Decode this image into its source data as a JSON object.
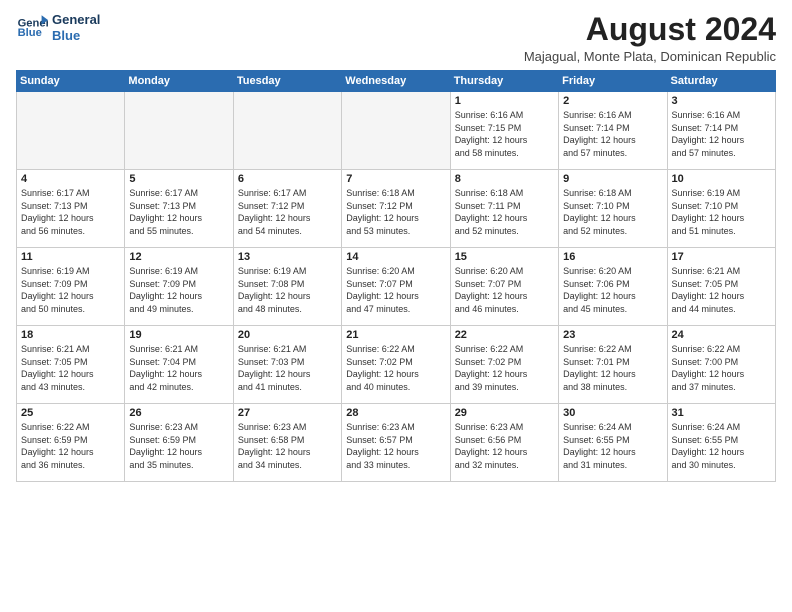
{
  "header": {
    "logo_line1": "General",
    "logo_line2": "Blue",
    "main_title": "August 2024",
    "subtitle": "Majagual, Monte Plata, Dominican Republic"
  },
  "calendar": {
    "days_of_week": [
      "Sunday",
      "Monday",
      "Tuesday",
      "Wednesday",
      "Thursday",
      "Friday",
      "Saturday"
    ],
    "weeks": [
      [
        {
          "day": "",
          "info": ""
        },
        {
          "day": "",
          "info": ""
        },
        {
          "day": "",
          "info": ""
        },
        {
          "day": "",
          "info": ""
        },
        {
          "day": "1",
          "info": "Sunrise: 6:16 AM\nSunset: 7:15 PM\nDaylight: 12 hours\nand 58 minutes."
        },
        {
          "day": "2",
          "info": "Sunrise: 6:16 AM\nSunset: 7:14 PM\nDaylight: 12 hours\nand 57 minutes."
        },
        {
          "day": "3",
          "info": "Sunrise: 6:16 AM\nSunset: 7:14 PM\nDaylight: 12 hours\nand 57 minutes."
        }
      ],
      [
        {
          "day": "4",
          "info": "Sunrise: 6:17 AM\nSunset: 7:13 PM\nDaylight: 12 hours\nand 56 minutes."
        },
        {
          "day": "5",
          "info": "Sunrise: 6:17 AM\nSunset: 7:13 PM\nDaylight: 12 hours\nand 55 minutes."
        },
        {
          "day": "6",
          "info": "Sunrise: 6:17 AM\nSunset: 7:12 PM\nDaylight: 12 hours\nand 54 minutes."
        },
        {
          "day": "7",
          "info": "Sunrise: 6:18 AM\nSunset: 7:12 PM\nDaylight: 12 hours\nand 53 minutes."
        },
        {
          "day": "8",
          "info": "Sunrise: 6:18 AM\nSunset: 7:11 PM\nDaylight: 12 hours\nand 52 minutes."
        },
        {
          "day": "9",
          "info": "Sunrise: 6:18 AM\nSunset: 7:10 PM\nDaylight: 12 hours\nand 52 minutes."
        },
        {
          "day": "10",
          "info": "Sunrise: 6:19 AM\nSunset: 7:10 PM\nDaylight: 12 hours\nand 51 minutes."
        }
      ],
      [
        {
          "day": "11",
          "info": "Sunrise: 6:19 AM\nSunset: 7:09 PM\nDaylight: 12 hours\nand 50 minutes."
        },
        {
          "day": "12",
          "info": "Sunrise: 6:19 AM\nSunset: 7:09 PM\nDaylight: 12 hours\nand 49 minutes."
        },
        {
          "day": "13",
          "info": "Sunrise: 6:19 AM\nSunset: 7:08 PM\nDaylight: 12 hours\nand 48 minutes."
        },
        {
          "day": "14",
          "info": "Sunrise: 6:20 AM\nSunset: 7:07 PM\nDaylight: 12 hours\nand 47 minutes."
        },
        {
          "day": "15",
          "info": "Sunrise: 6:20 AM\nSunset: 7:07 PM\nDaylight: 12 hours\nand 46 minutes."
        },
        {
          "day": "16",
          "info": "Sunrise: 6:20 AM\nSunset: 7:06 PM\nDaylight: 12 hours\nand 45 minutes."
        },
        {
          "day": "17",
          "info": "Sunrise: 6:21 AM\nSunset: 7:05 PM\nDaylight: 12 hours\nand 44 minutes."
        }
      ],
      [
        {
          "day": "18",
          "info": "Sunrise: 6:21 AM\nSunset: 7:05 PM\nDaylight: 12 hours\nand 43 minutes."
        },
        {
          "day": "19",
          "info": "Sunrise: 6:21 AM\nSunset: 7:04 PM\nDaylight: 12 hours\nand 42 minutes."
        },
        {
          "day": "20",
          "info": "Sunrise: 6:21 AM\nSunset: 7:03 PM\nDaylight: 12 hours\nand 41 minutes."
        },
        {
          "day": "21",
          "info": "Sunrise: 6:22 AM\nSunset: 7:02 PM\nDaylight: 12 hours\nand 40 minutes."
        },
        {
          "day": "22",
          "info": "Sunrise: 6:22 AM\nSunset: 7:02 PM\nDaylight: 12 hours\nand 39 minutes."
        },
        {
          "day": "23",
          "info": "Sunrise: 6:22 AM\nSunset: 7:01 PM\nDaylight: 12 hours\nand 38 minutes."
        },
        {
          "day": "24",
          "info": "Sunrise: 6:22 AM\nSunset: 7:00 PM\nDaylight: 12 hours\nand 37 minutes."
        }
      ],
      [
        {
          "day": "25",
          "info": "Sunrise: 6:22 AM\nSunset: 6:59 PM\nDaylight: 12 hours\nand 36 minutes."
        },
        {
          "day": "26",
          "info": "Sunrise: 6:23 AM\nSunset: 6:59 PM\nDaylight: 12 hours\nand 35 minutes."
        },
        {
          "day": "27",
          "info": "Sunrise: 6:23 AM\nSunset: 6:58 PM\nDaylight: 12 hours\nand 34 minutes."
        },
        {
          "day": "28",
          "info": "Sunrise: 6:23 AM\nSunset: 6:57 PM\nDaylight: 12 hours\nand 33 minutes."
        },
        {
          "day": "29",
          "info": "Sunrise: 6:23 AM\nSunset: 6:56 PM\nDaylight: 12 hours\nand 32 minutes."
        },
        {
          "day": "30",
          "info": "Sunrise: 6:24 AM\nSunset: 6:55 PM\nDaylight: 12 hours\nand 31 minutes."
        },
        {
          "day": "31",
          "info": "Sunrise: 6:24 AM\nSunset: 6:55 PM\nDaylight: 12 hours\nand 30 minutes."
        }
      ]
    ]
  }
}
